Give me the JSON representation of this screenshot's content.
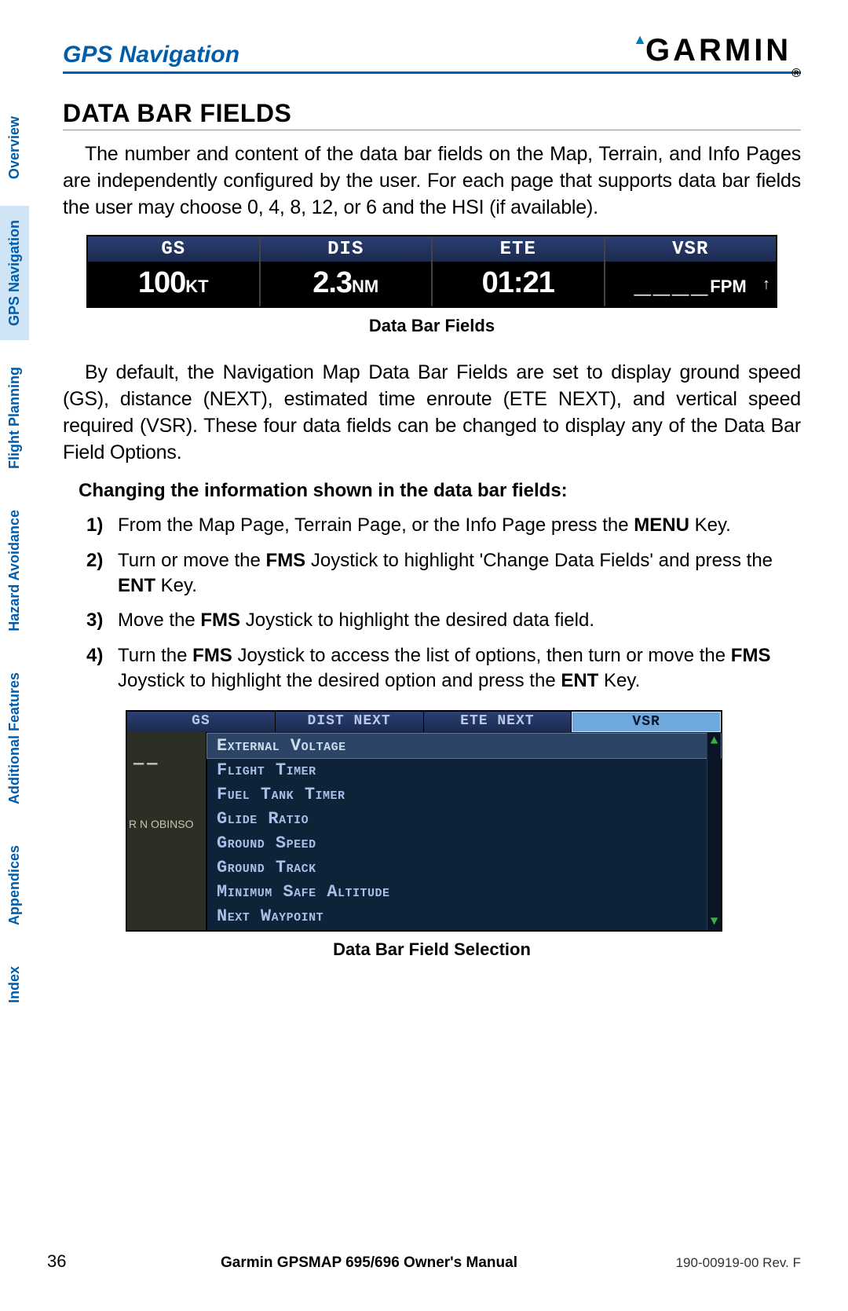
{
  "header": {
    "section": "GPS Navigation",
    "brand": "GARMIN"
  },
  "tabs": {
    "items": [
      "Overview",
      "GPS Navigation",
      "Flight Planning",
      "Hazard Avoidance",
      "Additional Features",
      "Appendices",
      "Index"
    ],
    "active_index": 1
  },
  "title": "DATA BAR FIELDS",
  "para1": "The number and content of the data bar fields on the Map, Terrain, and Info Pages are independently configured by the user.  For each page that supports data bar fields the user may choose 0, 4, 8, 12, or 6 and the HSI (if available).",
  "databar": {
    "cells": [
      {
        "label": "GS",
        "value": "100",
        "unit": "KT"
      },
      {
        "label": "DIS",
        "value": "2.3",
        "unit": "NM"
      },
      {
        "label": "ETE",
        "value": "01:21",
        "unit": ""
      },
      {
        "label": "VSR",
        "value": "____",
        "unit": "FPM",
        "arrow": "↑"
      }
    ],
    "caption": "Data Bar Fields"
  },
  "para2": "By default, the Navigation Map Data Bar Fields are set to display ground speed (GS), distance (NEXT), estimated time enroute (ETE NEXT), and vertical speed required (VSR). These four data fields can be changed to display any of the Data Bar Field Options.",
  "steps_heading": "Changing the information shown in the data bar fields:",
  "steps": [
    {
      "n": "1)",
      "html": "From the Map Page, Terrain Page, or the Info Page press the <b>MENU</b> Key."
    },
    {
      "n": "2)",
      "html": "Turn or move the <b>FMS</b> Joystick to highlight 'Change Data Fields' and press the <b>ENT</b> Key."
    },
    {
      "n": "3)",
      "html": "Move the <b>FMS</b> Joystick to highlight the desired data field."
    },
    {
      "n": "4)",
      "html": "Turn the <b>FMS</b> Joystick to access the list of options, then turn or move the <b>FMS</b> Joystick to highlight the desired option and press the <b>ENT</b> Key."
    }
  ],
  "selection": {
    "headers": [
      "GS",
      "DIST NEXT",
      "ETE NEXT",
      "VSR"
    ],
    "highlighted_header_index": 3,
    "left_dash": "——",
    "left_map": "R   N\nOBINSO",
    "options": [
      "External Voltage",
      "Flight Timer",
      "Fuel Tank Timer",
      "Glide Ratio",
      "Ground Speed",
      "Ground Track",
      "Minimum Safe Altitude",
      "Next Waypoint"
    ],
    "highlighted_option_index": 0,
    "caption": "Data Bar Field Selection"
  },
  "footer": {
    "page": "36",
    "manual": "Garmin GPSMAP 695/696 Owner's Manual",
    "rev": "190-00919-00  Rev. F"
  }
}
